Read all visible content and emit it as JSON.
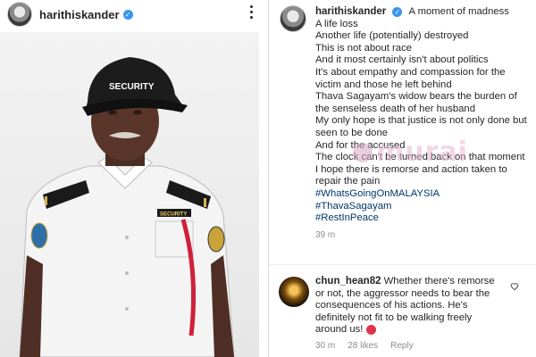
{
  "left": {
    "username": "harithiskander",
    "cap_text": "SECURITY",
    "badge_text": "SECURITY"
  },
  "post": {
    "username": "harithiskander",
    "caption_lines": [
      "A moment of madness",
      "A life loss",
      "Another life (potentially) destroyed",
      "This is not about race",
      "And it most certainly isn't about politics",
      "It's about empathy and compassion for the victim and those he left behind",
      "Thava Sagayam's widow bears the burden of the senseless death of her husband",
      "My only hope is that justice is not only done but seen to be done",
      "And for the accused",
      "The clock can't be turned back on that moment",
      "I hope there is remorse and action taken to repair the pain"
    ],
    "hashtags": [
      "#WhatsGoingOnMALAYSIA",
      "#ThavaSagayam",
      "#RestInPeace"
    ],
    "time": "39 m"
  },
  "comment": {
    "username": "chun_hean82",
    "text": "Whether there's remorse or not, the aggressor needs to bear the consequences of his actions. He's definitely not fit to be walking freely around us!",
    "time": "30 m",
    "likes": "28 likes",
    "reply": "Reply"
  },
  "watermark": {
    "text": "murai"
  },
  "colors": {
    "verified": "#3897f0",
    "hashtag": "#00376b",
    "muted": "#8e8e8e"
  },
  "icons": {
    "verified": "verified-badge-icon",
    "more": "more-options-icon",
    "like": "heart-icon"
  }
}
